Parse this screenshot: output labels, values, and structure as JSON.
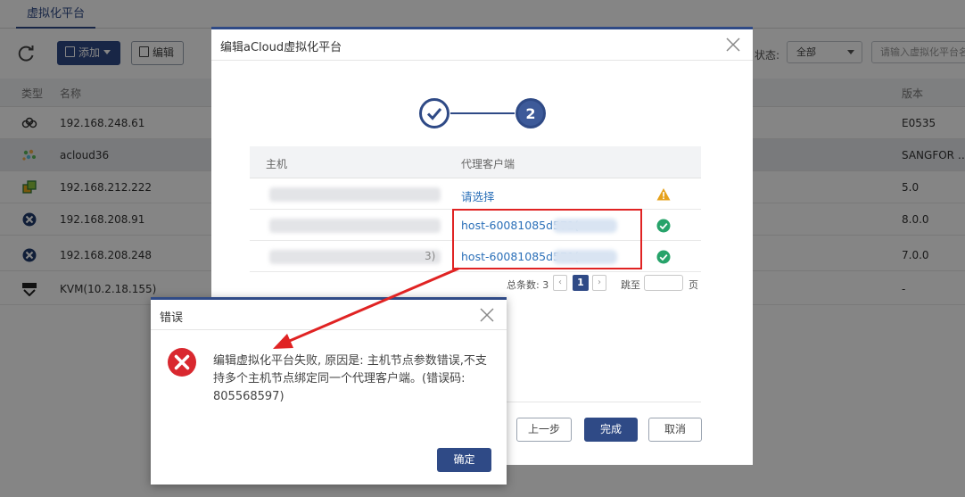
{
  "page": {
    "tab_label": "虚拟化平台",
    "toolbar": {
      "add_label": "添加",
      "edit_label": "编辑",
      "status_label": "状态:",
      "status_value": "全部",
      "search_placeholder": "请输入虚拟化平台名"
    },
    "columns": {
      "type": "类型",
      "name": "名称",
      "version": "版本"
    },
    "rows": [
      {
        "icon": "acloud-icon",
        "name": "192.168.248.61",
        "version": "E0535"
      },
      {
        "icon": "sangfor-icon",
        "name": "acloud36",
        "version": "SANGFOR …"
      },
      {
        "icon": "hyperv-icon",
        "name": "192.168.212.222",
        "version": "5.0"
      },
      {
        "icon": "xen-icon",
        "name": "192.168.208.91",
        "version": "8.0.0"
      },
      {
        "icon": "xen-icon",
        "name": "192.168.208.248",
        "version": "7.0.0"
      },
      {
        "icon": "kvm-icon",
        "name": "KVM(10.2.18.155)",
        "version": "-"
      }
    ]
  },
  "edit_dialog": {
    "title": "编辑aCloud虚拟化平台",
    "step2_label": "2",
    "columns": {
      "host": "主机",
      "agent": "代理客户端"
    },
    "rows": [
      {
        "host_suffix": "",
        "agent": "请选择",
        "status": "warning"
      },
      {
        "host_suffix": "",
        "agent": "host-60081085d571(",
        "status": "ok"
      },
      {
        "host_suffix": "3)",
        "agent": "host-60081085d571(",
        "status": "ok"
      }
    ],
    "pager": {
      "total_label": "总条数: 3",
      "current_page": "1",
      "goto_label": "跳至",
      "page_unit": "页"
    },
    "buttons": {
      "prev": "上一步",
      "finish": "完成",
      "cancel": "取消"
    },
    "colors": {
      "accent": "#2f4a86",
      "link": "#2a6fb8",
      "ok": "#27a36a",
      "warn": "#e6a11b",
      "highlight": "#e02323"
    }
  },
  "error_dialog": {
    "title": "错误",
    "message": "编辑虚拟化平台失败, 原因是: 主机节点参数错误,不支持多个主机节点绑定同一个代理客户端。(错误码: 805568597)",
    "ok_label": "确定",
    "colors": {
      "error": "#d9282f"
    }
  }
}
